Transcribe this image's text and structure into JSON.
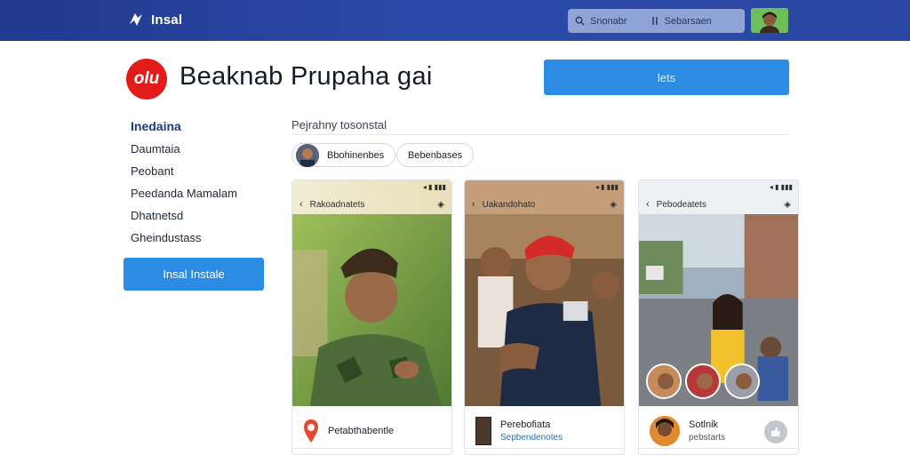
{
  "app": {
    "name": "Insal",
    "title": "Beaknab Prupaha gai"
  },
  "search": {
    "segment_1": "Snonabr",
    "segment_2": "Sebarsaen"
  },
  "header": {
    "primary_button_label": "lets"
  },
  "sidebar": {
    "items": [
      {
        "label": "Inedaina",
        "active": true
      },
      {
        "label": "Daumtaia",
        "active": false
      },
      {
        "label": "Peobant",
        "active": false
      },
      {
        "label": "Peedanda Mamalam",
        "active": false
      },
      {
        "label": "Dhatnetsd",
        "active": false
      },
      {
        "label": "Gheindustass",
        "active": false
      }
    ],
    "button_label": "Insal Instale"
  },
  "content": {
    "section_title": "Pejrahny tosonstal",
    "chips": [
      {
        "label": "Bbohinenbes"
      },
      {
        "label": "Bebenbases"
      }
    ],
    "cards": [
      {
        "header_title": "Rakoadnatets",
        "footer_title": "Petabthabentle",
        "footer_sub": ""
      },
      {
        "header_title": "Uakandohato",
        "footer_title": "Perebofiata",
        "footer_sub": "Sepbendenotes"
      },
      {
        "header_title": "Pebodeatets",
        "footer_title": "Sotlnik",
        "footer_sub": "pebstarts"
      }
    ]
  },
  "colors": {
    "topbar": "#223a8f",
    "accent": "#2c8be3",
    "logo": "#e21b1b"
  }
}
